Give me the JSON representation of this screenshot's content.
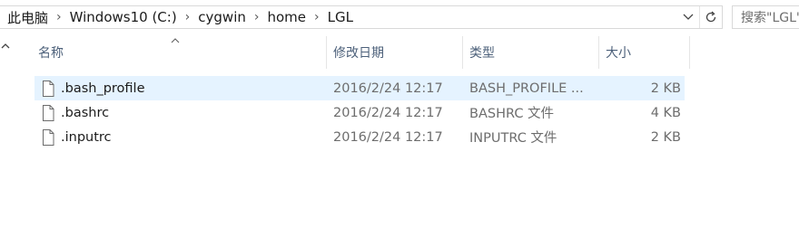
{
  "address_bar": {
    "crumbs": [
      "此电脑",
      "Windows10 (C:)",
      "cygwin",
      "home",
      "LGL"
    ],
    "separator": ">"
  },
  "search": {
    "placeholder": "搜索\"LGL\""
  },
  "columns": {
    "name": "名称",
    "date": "修改日期",
    "type": "类型",
    "size": "大小"
  },
  "files": [
    {
      "name": ".bash_profile",
      "date": "2016/2/24 12:17",
      "type": "BASH_PROFILE ...",
      "size": "2 KB",
      "selected": true
    },
    {
      "name": ".bashrc",
      "date": "2016/2/24 12:17",
      "type": "BASHRC 文件",
      "size": "4 KB",
      "selected": false
    },
    {
      "name": ".inputrc",
      "date": "2016/2/24 12:17",
      "type": "INPUTRC 文件",
      "size": "2 KB",
      "selected": false
    }
  ],
  "icons": {
    "address_dropdown": "chevron-down-icon",
    "refresh": "refresh-icon",
    "nav_collapse": "chevron-up-icon",
    "sort": "sort-ascending-icon",
    "file": "document-icon"
  },
  "colors": {
    "selection": "#e5f3ff",
    "header_text": "#4c607a",
    "secondary_text": "#6d6d6d"
  }
}
